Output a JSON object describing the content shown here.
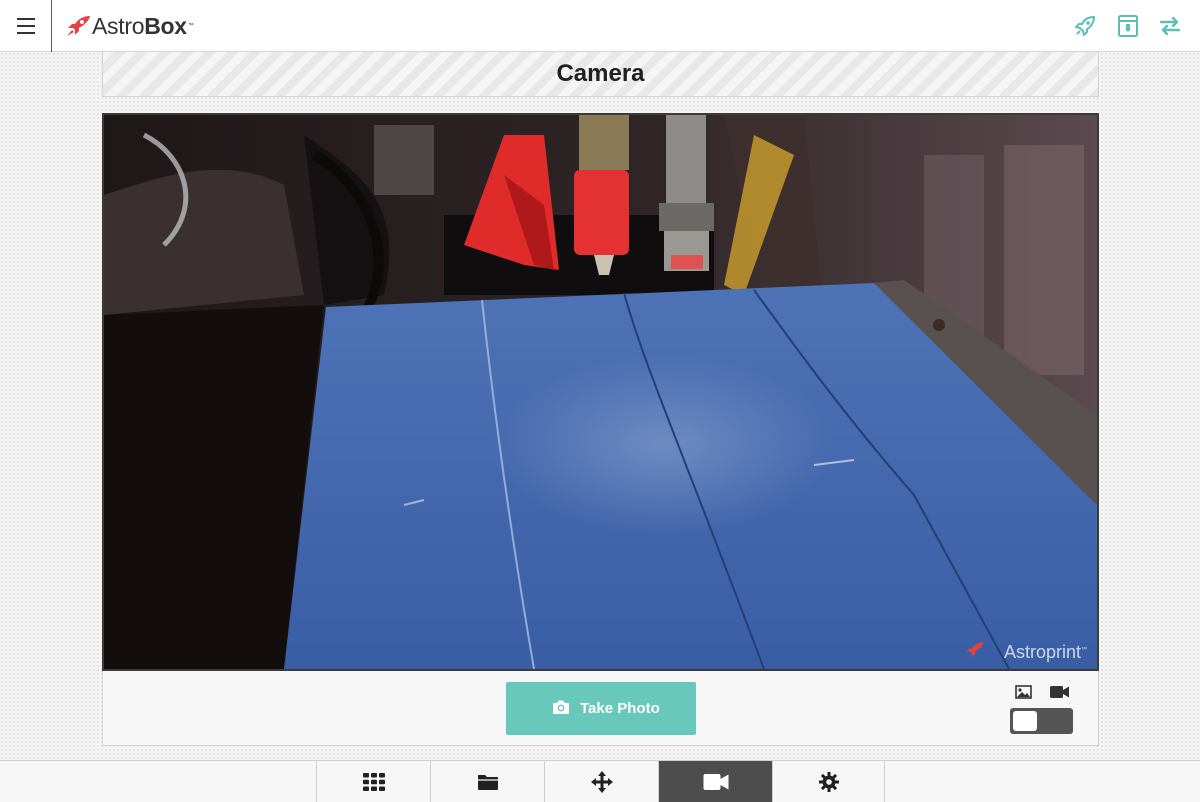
{
  "app": {
    "logo_text": "Astro",
    "logo_bold": "Box",
    "logo_tm": "™",
    "brand_color": "#e84141",
    "accent_color": "#5bbfb3"
  },
  "topbar": {
    "menu_icon": "hamburger-icon",
    "actions": [
      {
        "name": "launch-rocket-icon"
      },
      {
        "name": "printer-status-icon"
      },
      {
        "name": "transfer-arrows-icon"
      }
    ]
  },
  "page": {
    "title": "Camera"
  },
  "camera": {
    "feed_watermark_text": "Astroprint",
    "feed_watermark_tm": "™",
    "take_photo_label": "Take Photo",
    "mode_photo_icon": "image-icon",
    "mode_video_icon": "video-camera-icon",
    "video_mode_enabled": false
  },
  "bottom_nav": {
    "items": [
      {
        "name": "grid-icon",
        "active": false
      },
      {
        "name": "folder-icon",
        "active": false
      },
      {
        "name": "move-arrows-icon",
        "active": false
      },
      {
        "name": "video-camera-icon",
        "active": true
      },
      {
        "name": "gear-icon",
        "active": false
      }
    ]
  }
}
